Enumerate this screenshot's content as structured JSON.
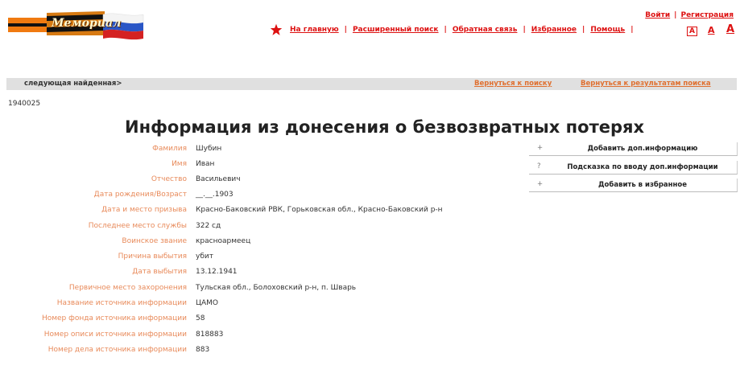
{
  "header": {
    "logo_text": "Мемориал",
    "login": "Войти",
    "register": "Регистрация",
    "nav": [
      "На главную",
      "Расширенный поиск",
      "Обратная связь",
      "Избранное",
      "Помощь"
    ],
    "font_size_labels": [
      "А",
      "А",
      "А"
    ]
  },
  "bar": {
    "next": "следующая найденная>",
    "back_search": "Вернуться к поиску",
    "back_results": "Вернуться к результатам поиска"
  },
  "record_id": "1940025",
  "title": "Информация из донесения о безвозвратных потерях",
  "fields": [
    {
      "label": "Фамилия",
      "value": "Шубин"
    },
    {
      "label": "Имя",
      "value": "Иван"
    },
    {
      "label": "Отчество",
      "value": "Васильевич"
    },
    {
      "label": "Дата рождения/Возраст",
      "value": "__.__.1903"
    },
    {
      "label": "Дата и место призыва",
      "value": "Красно-Баковский РВК, Горьковская обл., Красно-Баковский р-н"
    },
    {
      "label": "Последнее место службы",
      "value": "322 сд"
    },
    {
      "label": "Воинское звание",
      "value": "красноармеец"
    },
    {
      "label": "Причина выбытия",
      "value": "убит"
    },
    {
      "label": "Дата выбытия",
      "value": "13.12.1941"
    },
    {
      "label": "Первичное место захоронения",
      "value": "Тульская обл., Болоховский р-н, п. Шварь"
    },
    {
      "label": "Название источника информации",
      "value": "ЦАМО"
    },
    {
      "label": "Номер фонда источника информации",
      "value": "58"
    },
    {
      "label": "Номер описи источника информации",
      "value": "818883"
    },
    {
      "label": "Номер дела источника информации",
      "value": "883"
    }
  ],
  "actions": [
    {
      "icon": "+",
      "label": "Добавить доп.информацию"
    },
    {
      "icon": "?",
      "label": "Подсказка по вводу доп.информации"
    },
    {
      "icon": "+",
      "label": "Добавить в избранное"
    }
  ]
}
